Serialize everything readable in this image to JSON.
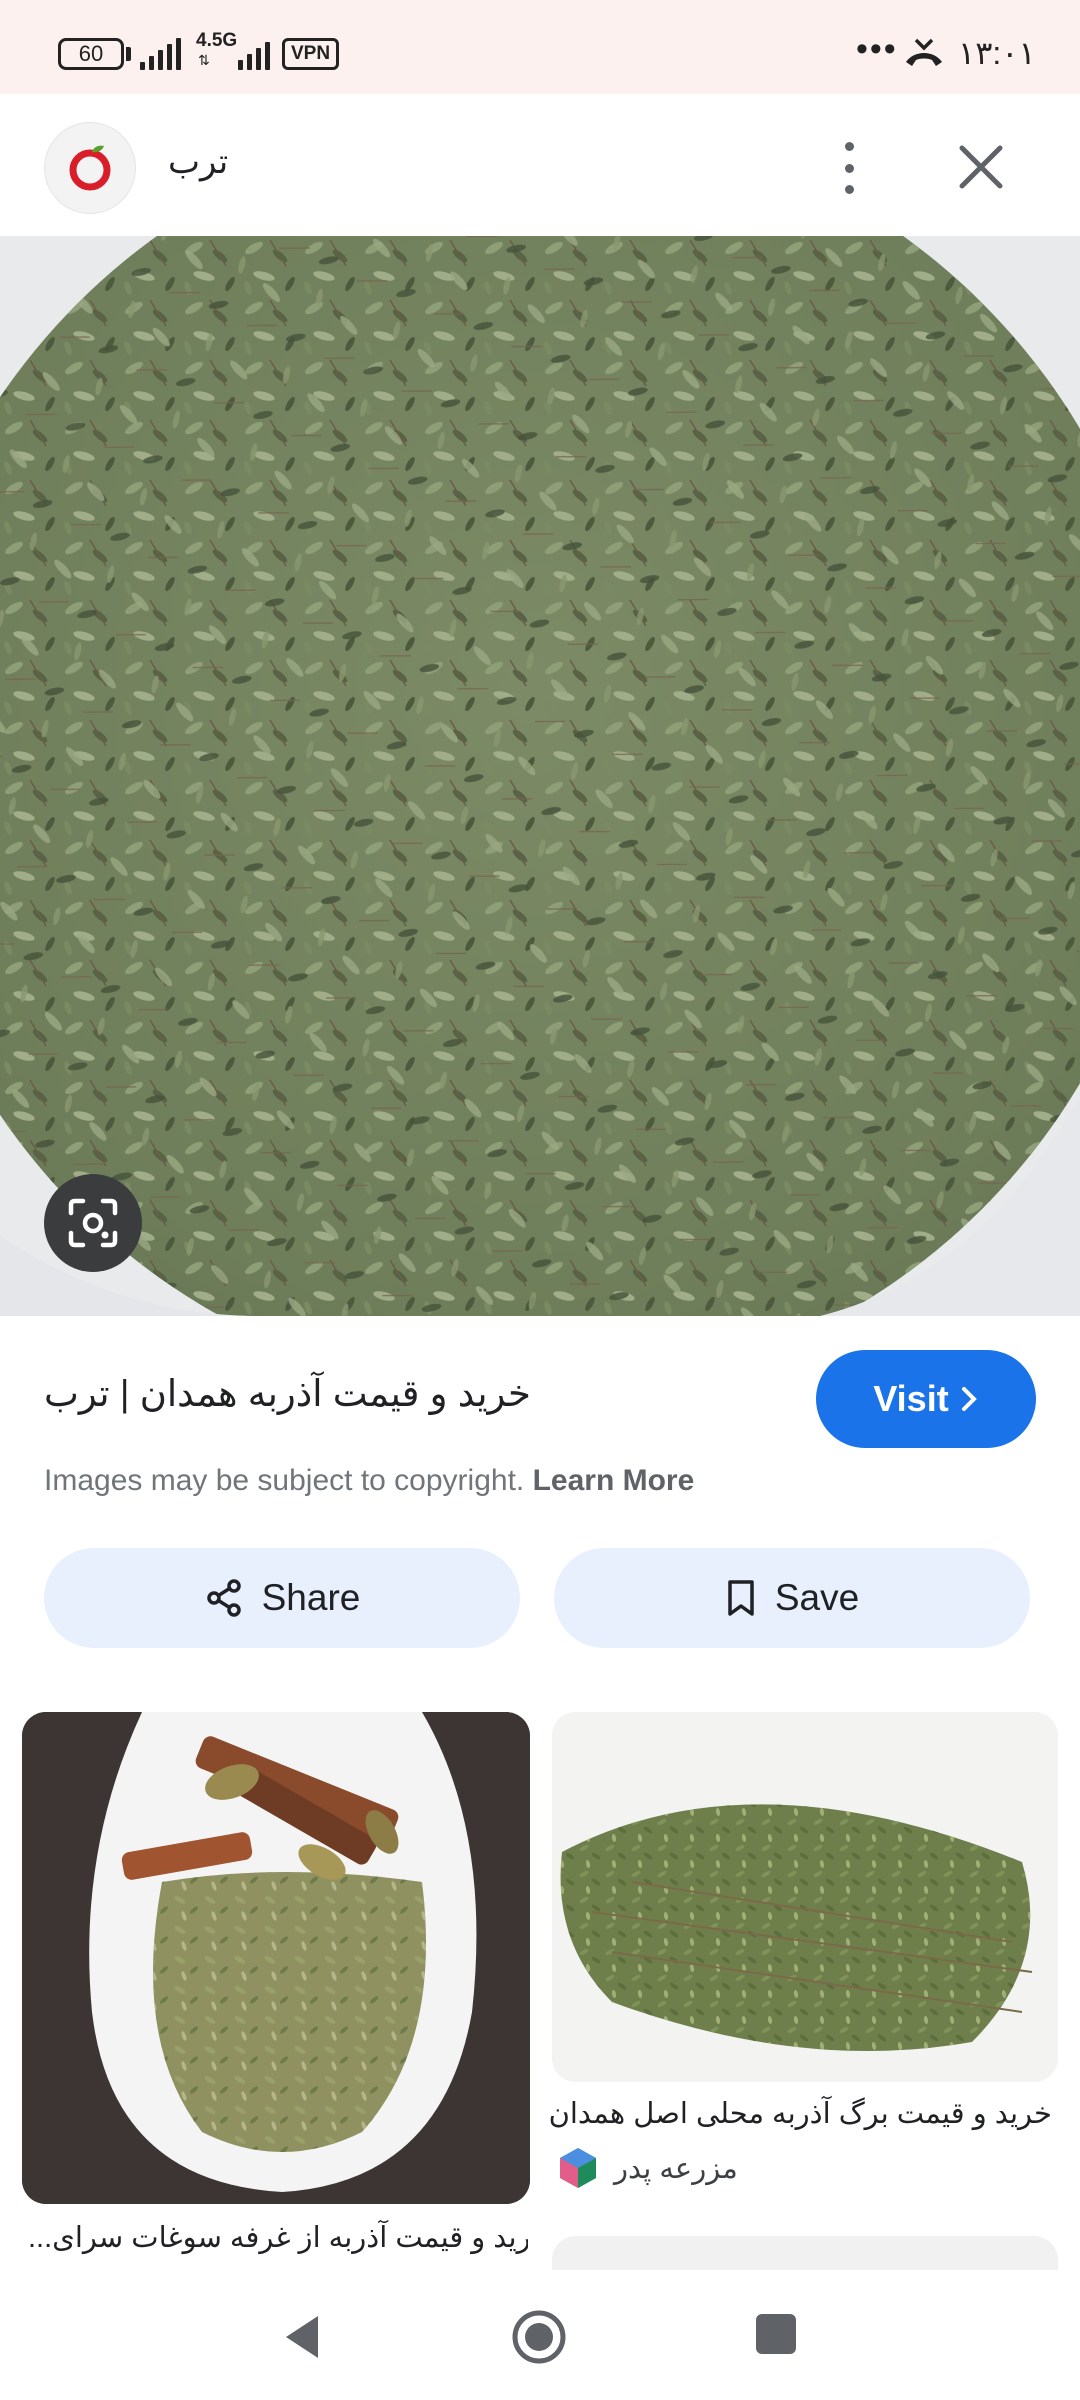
{
  "status_bar": {
    "battery": "60",
    "network": "4.5G",
    "vpn": "VPN",
    "more": "•••",
    "time": "۱۳:۰۱"
  },
  "header": {
    "site_name": "ترب",
    "logo_icon": "torob-logo-icon",
    "menu_icon": "more-vert-icon",
    "close_icon": "close-icon"
  },
  "main_image": {
    "subject": "dried thyme leaves",
    "lens_icon": "google-lens-icon"
  },
  "result": {
    "title": "خرید و قیمت آذربه همدان | ترب",
    "visit_label": "Visit",
    "copyright_text": "Images may be subject to copyright.",
    "learn_more": "Learn More"
  },
  "actions": {
    "share_label": "Share",
    "save_label": "Save"
  },
  "related": [
    {
      "caption": "خرید و قیمت آذربه از غرفه سوغات سرای",
      "display": "...رید و قیمت آذربه از غرفه سوغات سرای"
    },
    {
      "caption": "خرید و قیمت برگ آذربه محلی اصل همدان",
      "source": "مزرعه پدر"
    }
  ],
  "colors": {
    "accent": "#1a73e8",
    "chip": "#e8f0fe",
    "status_bg": "#fcf1ef"
  },
  "nav": {
    "back_icon": "back-triangle-icon",
    "home_icon": "home-circle-icon",
    "recent_icon": "recents-square-icon"
  }
}
